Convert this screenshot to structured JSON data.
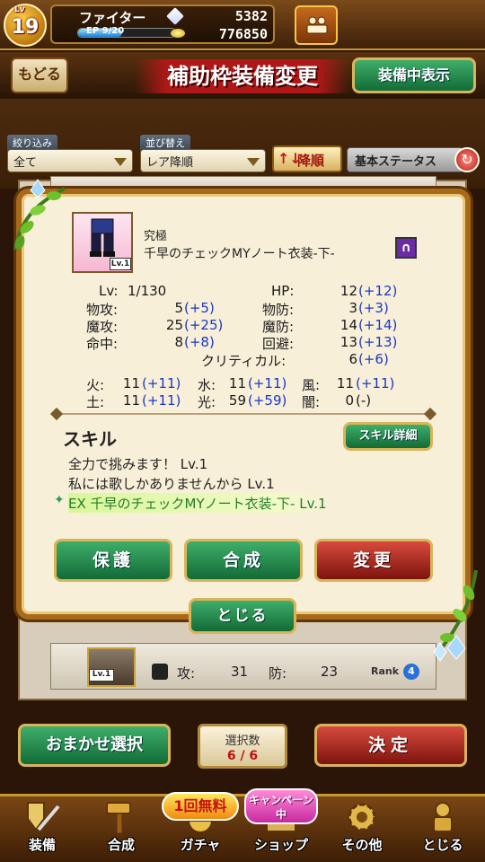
{
  "status": {
    "level_tag": "Lv",
    "level": "19",
    "player_name": "ファイター",
    "ep_label": "EP",
    "ep_value": "9/20",
    "ep_fraction": 0.45,
    "gems": "5382",
    "coins": "776850"
  },
  "header": {
    "back_label": "もどる",
    "title": "補助枠装備変更",
    "equipped_view_label": "装備中表示"
  },
  "filters": {
    "filter_label": "絞り込み",
    "filter_value": "全て",
    "sort_label": "並び替え",
    "sort_value": "レア降順",
    "order_label": "降順",
    "order_arrows": "↑↓",
    "stat_label": "基本ステータス"
  },
  "list_bottom": {
    "lv": "Lv.1",
    "atk_label": "攻:",
    "atk_value": "31",
    "def_label": "防:",
    "def_value": "23",
    "rank_label": "Rank",
    "rank_value": "4"
  },
  "item": {
    "rarity": "究極",
    "name": "千早のチェックMYノート衣装-下-",
    "lv_badge": "Lv.1",
    "type_icon": "leg-armor-icon",
    "stats": {
      "lv_label": "Lv:",
      "lv_value": "1/130",
      "hp_label": "HP:",
      "hp_value": "12",
      "hp_bonus": "(+12)",
      "patk_label": "物攻:",
      "patk_value": "5",
      "patk_bonus": "(+5)",
      "pdef_label": "物防:",
      "pdef_value": "3",
      "pdef_bonus": "(+3)",
      "matk_label": "魔攻:",
      "matk_value": "25",
      "matk_bonus": "(+25)",
      "mdef_label": "魔防:",
      "mdef_value": "14",
      "mdef_bonus": "(+14)",
      "hit_label": "命中:",
      "hit_value": "8",
      "hit_bonus": "(+8)",
      "eva_label": "回避:",
      "eva_value": "13",
      "eva_bonus": "(+13)",
      "crit_label": "クリティカル:",
      "crit_value": "6",
      "crit_bonus": "(+6)"
    },
    "elements": {
      "fire_label": "火:",
      "fire_value": "11",
      "fire_bonus": "(+11)",
      "water_label": "水:",
      "water_value": "11",
      "water_bonus": "(+11)",
      "wind_label": "風:",
      "wind_value": "11",
      "wind_bonus": "(+11)",
      "earth_label": "土:",
      "earth_value": "11",
      "earth_bonus": "(+11)",
      "light_label": "光:",
      "light_value": "59",
      "light_bonus": "(+59)",
      "dark_label": "闇:",
      "dark_value": "0",
      "dark_bonus": "(-)"
    }
  },
  "skills": {
    "heading": "スキル",
    "detail_button": "スキル詳細",
    "items": [
      "全力で挑みます！ Lv.1",
      "私には歌しかありませんから Lv.1",
      "EX 千早のチェックMYノート衣装-下- Lv.1"
    ]
  },
  "actions": {
    "protect": "保護",
    "synthesize": "合成",
    "change": "変更",
    "close": "とじる"
  },
  "selection": {
    "auto_select": "おまかせ選択",
    "count_label": "選択数",
    "count_value": "6 / 6",
    "decide": "決定"
  },
  "nav": {
    "free_banner": "1回無料",
    "campaign_banner": "キャンペーン中",
    "items": [
      {
        "label": "装備",
        "icon": "sword-shield-icon"
      },
      {
        "label": "合成",
        "icon": "hammer-icon"
      },
      {
        "label": "ガチャ",
        "icon": "gacha-icon"
      },
      {
        "label": "ショップ",
        "icon": "shop-icon"
      },
      {
        "label": "その他",
        "icon": "gear-icon"
      },
      {
        "label": "とじる",
        "icon": "close-statue-icon"
      }
    ]
  },
  "colors": {
    "accent_gold": "#c8962e",
    "button_green": "#1f8a4a",
    "button_red": "#b02018",
    "bonus_blue": "#1a38c8"
  }
}
